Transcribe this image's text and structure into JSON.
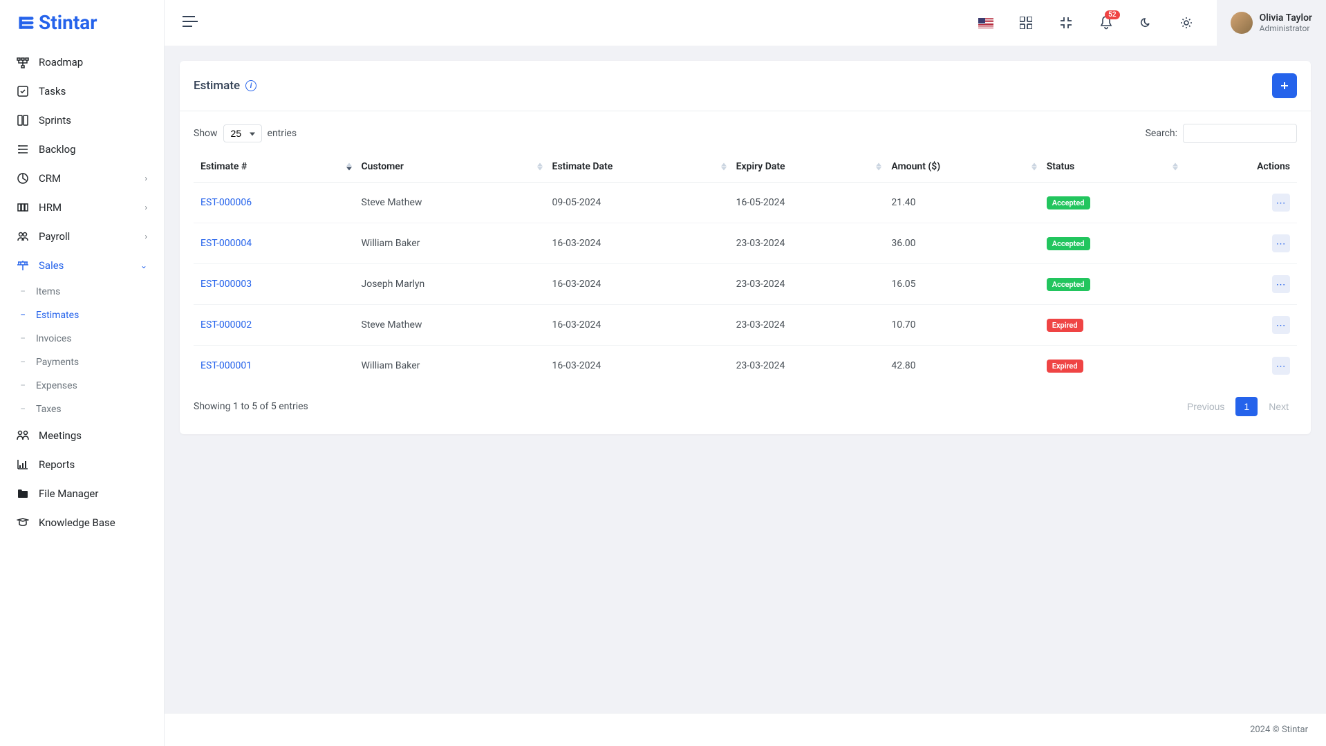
{
  "brand": "Stintar",
  "notifications": {
    "count": "52"
  },
  "user": {
    "name": "Olivia Taylor",
    "role": "Administrator"
  },
  "sidebar": {
    "items": [
      {
        "label": "Roadmap"
      },
      {
        "label": "Tasks"
      },
      {
        "label": "Sprints"
      },
      {
        "label": "Backlog"
      },
      {
        "label": "CRM",
        "expandable": true
      },
      {
        "label": "HRM",
        "expandable": true
      },
      {
        "label": "Payroll",
        "expandable": true
      },
      {
        "label": "Sales",
        "expandable": true,
        "active": true,
        "expanded": true
      },
      {
        "label": "Meetings"
      },
      {
        "label": "Reports"
      },
      {
        "label": "File Manager"
      },
      {
        "label": "Knowledge Base"
      }
    ],
    "sales_sub": [
      {
        "label": "Items"
      },
      {
        "label": "Estimates",
        "active": true
      },
      {
        "label": "Invoices"
      },
      {
        "label": "Payments"
      },
      {
        "label": "Expenses"
      },
      {
        "label": "Taxes"
      }
    ]
  },
  "page": {
    "title": "Estimate",
    "show_label_pre": "Show",
    "show_label_post": "entries",
    "entries_value": "25",
    "search_label": "Search:",
    "columns": {
      "estimate_no": "Estimate #",
      "customer": "Customer",
      "estimate_date": "Estimate Date",
      "expiry_date": "Expiry Date",
      "amount": "Amount ($)",
      "status": "Status",
      "actions": "Actions"
    },
    "rows": [
      {
        "id": "EST-000006",
        "customer": "Steve Mathew",
        "date": "09-05-2024",
        "expiry": "16-05-2024",
        "amount": "21.40",
        "status": "Accepted",
        "status_class": "accepted"
      },
      {
        "id": "EST-000004",
        "customer": "William Baker",
        "date": "16-03-2024",
        "expiry": "23-03-2024",
        "amount": "36.00",
        "status": "Accepted",
        "status_class": "accepted"
      },
      {
        "id": "EST-000003",
        "customer": "Joseph Marlyn",
        "date": "16-03-2024",
        "expiry": "23-03-2024",
        "amount": "16.05",
        "status": "Accepted",
        "status_class": "accepted"
      },
      {
        "id": "EST-000002",
        "customer": "Steve Mathew",
        "date": "16-03-2024",
        "expiry": "23-03-2024",
        "amount": "10.70",
        "status": "Expired",
        "status_class": "expired"
      },
      {
        "id": "EST-000001",
        "customer": "William Baker",
        "date": "16-03-2024",
        "expiry": "23-03-2024",
        "amount": "42.80",
        "status": "Expired",
        "status_class": "expired"
      }
    ],
    "footer_info": "Showing 1 to 5 of 5 entries",
    "pagination": {
      "prev": "Previous",
      "next": "Next",
      "current": "1"
    }
  },
  "footer": "2024 © Stintar"
}
